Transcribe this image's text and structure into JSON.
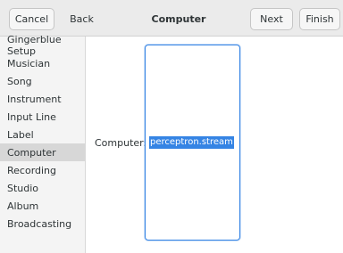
{
  "header": {
    "cancel_label": "Cancel",
    "back_label": "Back",
    "title": "Computer",
    "next_label": "Next",
    "finish_label": "Finish"
  },
  "sidebar": {
    "items": [
      {
        "label": "Gingerblue Setup"
      },
      {
        "label": "Musician"
      },
      {
        "label": "Song"
      },
      {
        "label": "Instrument"
      },
      {
        "label": "Input Line"
      },
      {
        "label": "Label"
      },
      {
        "label": "Computer",
        "selected": true
      },
      {
        "label": "Recording"
      },
      {
        "label": "Studio"
      },
      {
        "label": "Album"
      },
      {
        "label": "Broadcasting"
      }
    ]
  },
  "form": {
    "computer_label": "Computer:",
    "computer_value": "perceptron.stream"
  },
  "colors": {
    "accent": "#3584e4",
    "header_bg": "#ebebeb",
    "sidebar_bg": "#f4f4f4",
    "selected_bg": "#d7d7d7"
  }
}
